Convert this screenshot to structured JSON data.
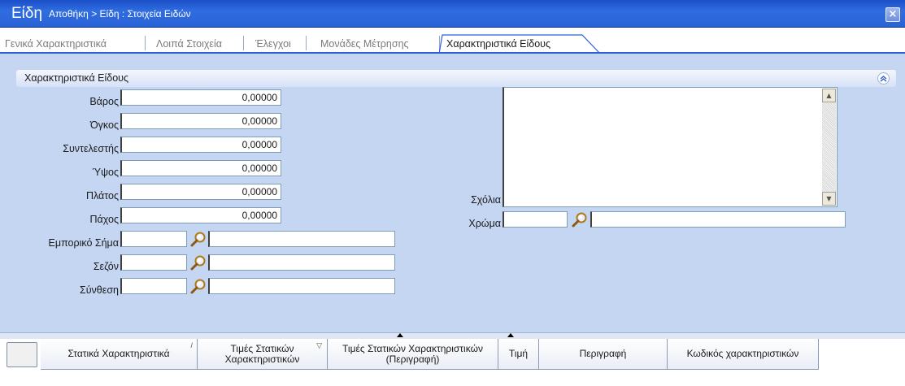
{
  "titlebar": {
    "title": "Είδη",
    "breadcrumb": "Αποθήκη > Είδη : Στοιχεία Ειδών",
    "close_glyph": "×"
  },
  "tabs": [
    {
      "label": "Γενικά Χαρακτηριστικά"
    },
    {
      "label": "Λοιπά Στοιχεία"
    },
    {
      "label": "Έλεγχοι"
    },
    {
      "label": "Μονάδες Μέτρησης"
    },
    {
      "label": "Χαρακτηριστικά Είδους"
    }
  ],
  "section": {
    "title": "Χαρακτηριστικά Είδους",
    "collapse_glyph": "»"
  },
  "fields": {
    "weight": {
      "label": "Βάρος",
      "value": "0,00000"
    },
    "volume": {
      "label": "Όγκος",
      "value": "0,00000"
    },
    "factor": {
      "label": "Συντελεστής",
      "value": "0,00000"
    },
    "height": {
      "label": "Ύψος",
      "value": "0,00000"
    },
    "width": {
      "label": "Πλάτος",
      "value": "0,00000"
    },
    "thickness": {
      "label": "Πάχος",
      "value": "0,00000"
    },
    "brand": {
      "label": "Εμπορικό Σήμα",
      "code": "",
      "desc": ""
    },
    "season": {
      "label": "Σεζόν",
      "code": "",
      "desc": ""
    },
    "composition": {
      "label": "Σύνθεση",
      "code": "",
      "desc": ""
    },
    "notes": {
      "label": "Σχόλια",
      "value": ""
    },
    "color": {
      "label": "Χρώμα",
      "code": "",
      "desc": ""
    }
  },
  "grid": {
    "columns": [
      {
        "label": "Στατικά Χαρακτηριστικά"
      },
      {
        "label": "Τιμές Στατικών Χαρακτηριστικών"
      },
      {
        "label": "Τιμές Στατικών Χαρακτηριστικών (Περιγραφή)"
      },
      {
        "label": "Τιμή"
      },
      {
        "label": "Περιγραφή"
      },
      {
        "label": "Κωδικός χαρακτηριστικών"
      }
    ]
  },
  "colors": {
    "titlebar": "#2a62d6",
    "panel": "#c5d6f2",
    "tab_line": "#2c5fd3"
  },
  "icons": [
    "close-icon",
    "collapse-up-icon",
    "search-icon",
    "scroll-up-icon",
    "scroll-down-icon"
  ]
}
